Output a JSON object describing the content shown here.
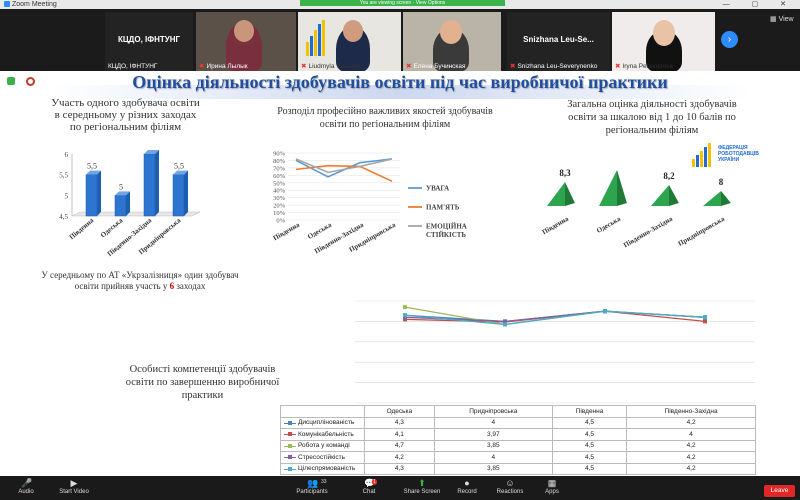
{
  "window": {
    "title": "Zoom Meeting",
    "controls": "—  ▢  ✕"
  },
  "share_banner": "You are viewing screen · View Options",
  "participants": [
    {
      "big": "КЦДО, ІФНТУНГ",
      "name": "КЦДО, ІФНТУНГ"
    },
    {
      "name": "Ирина Лылык"
    },
    {
      "name": "Liudmyla Vasilega"
    },
    {
      "name": "Елена Бучинская"
    },
    {
      "big": "Snizhana Leu-Se...",
      "name": "Snizhana Leu-Severynenko"
    },
    {
      "name": "Iryna Perevozova"
    }
  ],
  "view_label": "View",
  "slide": {
    "title": "Оцінка діяльності здобувачів освіти під час виробничої практики",
    "chart1_title": "Участь одного здобувача освіти в середньому у різних заходах по регіональним філіям",
    "chart2_title": "Розподіл професійно важливих якостей здобувачів освіти по регіональним філіям",
    "chart3_title": "Загальна оцінка діяльності здобувачів освіти за шкалою від 1 до 10 балів по регіональним філіям",
    "note_text": "У середньому по АТ «Укрзалізниця» один здобувач освіти прийняв участь у ",
    "note_num": "6",
    "note_tail": "заходах",
    "chart4_title": "Особисті компетенції здобувачів освіти по завершенню виробничої практики",
    "fed_logo_text": "ФЕДЕРАЦІЯ РОБОТОДАВЦІВ УКРАЇНИ"
  },
  "chart_data": [
    {
      "type": "bar",
      "categories": [
        "Південна",
        "Одеська",
        "Південно-Західна",
        "Придніпровська"
      ],
      "values": [
        5.5,
        5,
        6,
        5.5
      ],
      "yticks": [
        "4,5",
        "5",
        "5,5",
        "6"
      ],
      "ylim": [
        4.5,
        6
      ],
      "color": "#2e75d2"
    },
    {
      "type": "line",
      "categories": [
        "Південна",
        "Одеська",
        "Південно-Західна",
        "Придніпровська"
      ],
      "yticks": [
        "0%",
        "10%",
        "20%",
        "30%",
        "40%",
        "50%",
        "60%",
        "70%",
        "80%",
        "90%"
      ],
      "ylim": [
        0,
        90
      ],
      "series": [
        {
          "name": "УВАГА",
          "values": [
            80,
            58,
            77,
            82
          ],
          "color": "#5b9bd5"
        },
        {
          "name": "ПАМ'ЯТЬ",
          "values": [
            68,
            73,
            72,
            52
          ],
          "color": "#ed7d31"
        },
        {
          "name": "ЕМОЦІЙНА СТІЙКІСТЬ",
          "values": [
            82,
            64,
            72,
            82
          ],
          "color": "#a5a5a5"
        }
      ]
    },
    {
      "type": "bar",
      "categories": [
        "Південна",
        "Одеська",
        "Південно-Західна",
        "Придніпровська"
      ],
      "values": [
        8.3,
        8.7,
        8.2,
        8
      ],
      "labels": [
        "8,3",
        "8,7",
        "8,2",
        "8"
      ],
      "color": "#2ea44f"
    },
    {
      "type": "line",
      "categories": [
        "Одеська",
        "Придніпровська",
        "Південна",
        "Південно-Західна"
      ],
      "series": [
        {
          "name": "Дисциплінованість",
          "values": [
            4.3,
            4,
            4.5,
            4.2
          ],
          "labels": [
            "4,3",
            "4",
            "4,5",
            "4,2"
          ],
          "color": "#4f81bd"
        },
        {
          "name": "Комунікабельність",
          "values": [
            4.1,
            3.97,
            4.5,
            4
          ],
          "labels": [
            "4,1",
            "3,97",
            "4,5",
            "4"
          ],
          "color": "#c0504d"
        },
        {
          "name": "Робота у команді",
          "values": [
            4.7,
            3.85,
            4.5,
            4.2
          ],
          "labels": [
            "4,7",
            "3,85",
            "4,5",
            "4,2"
          ],
          "color": "#9bbb59"
        },
        {
          "name": "Стресостійкість",
          "values": [
            4.2,
            4,
            4.5,
            4.2
          ],
          "labels": [
            "4,2",
            "4",
            "4,5",
            "4,2"
          ],
          "color": "#8064a2"
        },
        {
          "name": "Цілеспрямованість",
          "values": [
            4.3,
            3.85,
            4.5,
            4.2
          ],
          "labels": [
            "4,3",
            "3,85",
            "4,5",
            "4,2"
          ],
          "color": "#4bacc6"
        }
      ]
    }
  ],
  "toolbar": {
    "items": [
      {
        "label": "Audio",
        "icon": "microphone-icon"
      },
      {
        "label": "Start Video",
        "icon": "video-icon"
      },
      {
        "label": "Participants",
        "icon": "participants-icon",
        "count": "33"
      },
      {
        "label": "Chat",
        "icon": "chat-icon",
        "count": "1"
      },
      {
        "label": "Share Screen",
        "icon": "share-screen-icon"
      },
      {
        "label": "Record",
        "icon": "record-icon"
      },
      {
        "label": "Reactions",
        "icon": "reactions-icon"
      },
      {
        "label": "Apps",
        "icon": "apps-icon"
      }
    ],
    "leave_label": "Leave"
  }
}
